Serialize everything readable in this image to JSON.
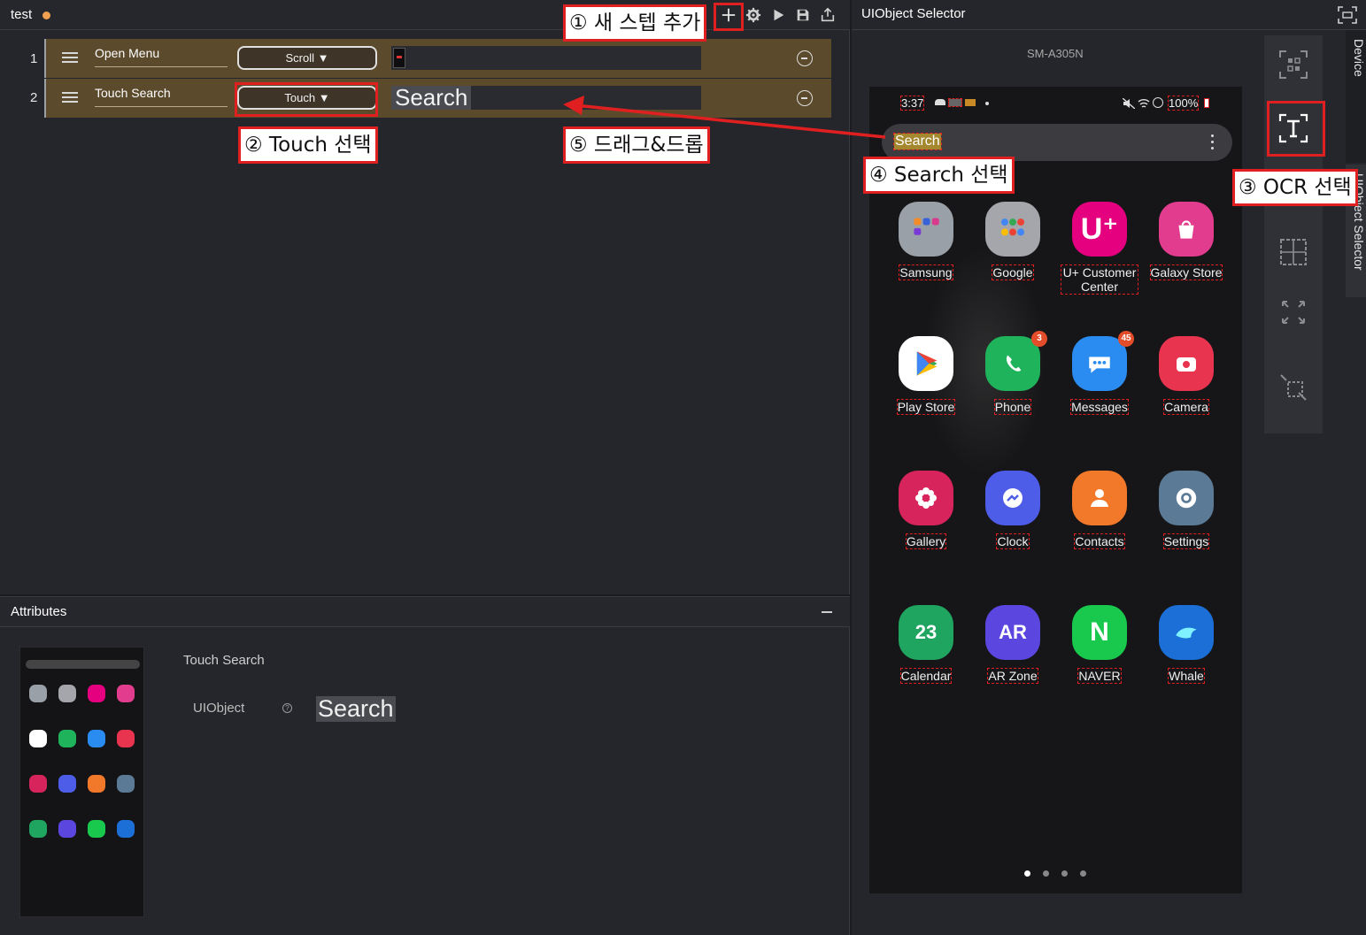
{
  "editor": {
    "project_title": "test",
    "toolbar": [
      "add-step",
      "settings",
      "play",
      "save",
      "export"
    ],
    "steps": [
      {
        "number": "1",
        "name": "Open Menu",
        "action": "Scroll ▼",
        "target": ""
      },
      {
        "number": "2",
        "name": "Touch Search",
        "action": "Touch ▼",
        "target": "Search"
      }
    ]
  },
  "attributes": {
    "title": "Attributes",
    "step_name": "Touch Search",
    "uiobject_label": "UIObject",
    "help": "?",
    "uiobject_value": "Search"
  },
  "selector": {
    "title": "UIObject Selector",
    "device_name": "SM-A305N",
    "tabs": [
      "Device",
      "UIObject Selector"
    ]
  },
  "phone": {
    "time": "3:37",
    "status_right": "100%",
    "search_label": "Search",
    "apps": [
      {
        "label": "Samsung",
        "color": "#9aa0a8"
      },
      {
        "label": "Google",
        "color": "#a4a6ab"
      },
      {
        "label": "U+ Customer Center",
        "color": "#e4007f"
      },
      {
        "label": "Galaxy Store",
        "color": "#e23c8e"
      },
      {
        "label": "Play Store",
        "color": "#ffffff"
      },
      {
        "label": "Phone",
        "color": "#1fb45b",
        "badge": "3"
      },
      {
        "label": "Messages",
        "color": "#2a8cf0",
        "badge": "45"
      },
      {
        "label": "Camera",
        "color": "#e8344e"
      },
      {
        "label": "Gallery",
        "color": "#d8245c"
      },
      {
        "label": "Clock",
        "color": "#4d5de8"
      },
      {
        "label": "Contacts",
        "color": "#f2792a"
      },
      {
        "label": "Settings",
        "color": "#5a7a95"
      },
      {
        "label": "Calendar",
        "color": "#1fa560",
        "glyph": "23"
      },
      {
        "label": "AR Zone",
        "color": "#5b47e0",
        "glyph": "AR"
      },
      {
        "label": "NAVER",
        "color": "#19c94d",
        "glyph": "N"
      },
      {
        "label": "Whale",
        "color": "#1c6fd6"
      }
    ],
    "app_glyphs": {
      "u_plus": "U⁺"
    }
  },
  "annotations": {
    "a1": "① 새 스텝 추가",
    "a2": "② Touch 선택",
    "a3": "③ OCR 선택",
    "a4": "④ Search 선택",
    "a5": "⑤ 드래그&드롭"
  },
  "colors": {
    "annotation_red": "#e02020",
    "step_row": "#5b4a2c",
    "search_highlight": "#c8a028"
  }
}
